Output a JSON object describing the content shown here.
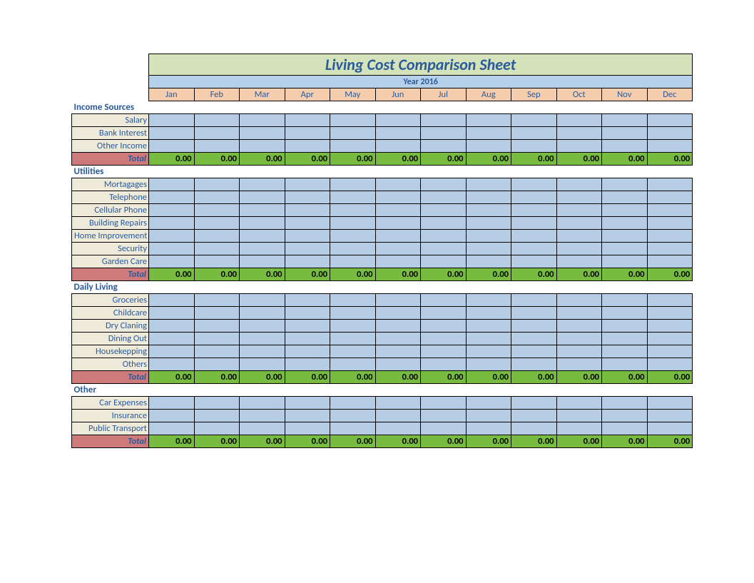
{
  "title": "Living Cost Comparison Sheet",
  "year": "Year 2016",
  "months": [
    "Jan",
    "Feb",
    "Mar",
    "Apr",
    "May",
    "Jun",
    "Jul",
    "Aug",
    "Sep",
    "Oct",
    "Nov",
    "Dec"
  ],
  "total_label": "Total",
  "total_value": "0.00",
  "sections": [
    {
      "name": "Income Sources",
      "rows": [
        "Salary",
        "Bank Interest",
        "Other Income"
      ]
    },
    {
      "name": "Utilities",
      "rows": [
        "Mortagages",
        "Telephone",
        "Cellular Phone",
        "Building Repairs",
        "Home Improvement",
        "Security",
        "Garden Care"
      ]
    },
    {
      "name": "Daily Living",
      "rows": [
        "Groceries",
        "Childcare",
        "Dry Claning",
        "Dining Out",
        "Housekepping",
        "Others"
      ]
    },
    {
      "name": "Other",
      "rows": [
        "Car Expenses",
        "Insurance",
        "Public Transport"
      ]
    }
  ]
}
